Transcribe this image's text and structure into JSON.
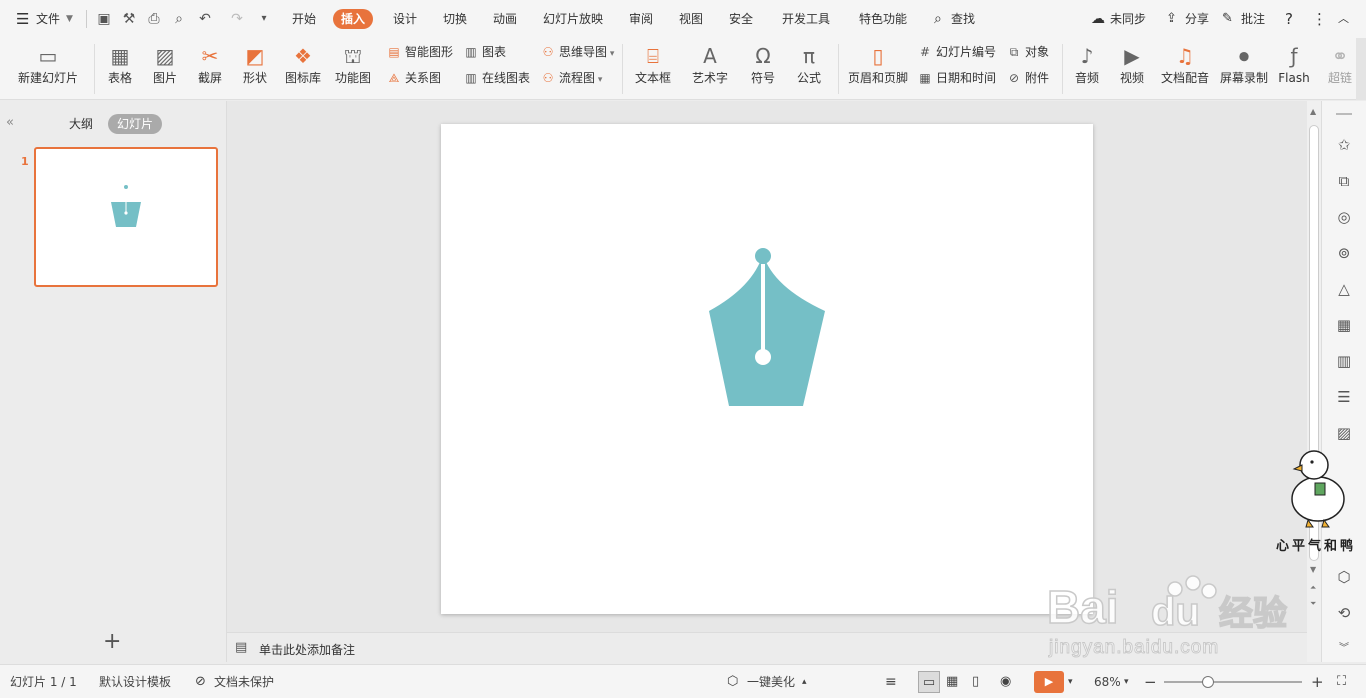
{
  "colors": {
    "accent": "#e8733c",
    "shape": "#75bfc6",
    "slide_bg": "#ffffff"
  },
  "menu": {
    "file_label": "文件",
    "tabs": [
      "开始",
      "插入",
      "设计",
      "切换",
      "动画",
      "幻灯片放映",
      "审阅",
      "视图",
      "安全",
      "开发工具",
      "特色功能"
    ],
    "active_tab": "插入",
    "search_label": "查找",
    "sync_label": "未同步",
    "share_label": "分享",
    "comment_label": "批注"
  },
  "ribbon": {
    "big": [
      {
        "label": "新建幻灯片",
        "icon": "new-slide-icon"
      },
      {
        "label": "表格",
        "icon": "table-icon"
      },
      {
        "label": "图片",
        "icon": "picture-icon"
      },
      {
        "label": "截屏",
        "icon": "screenshot-icon"
      },
      {
        "label": "形状",
        "icon": "shape-icon"
      },
      {
        "label": "图标库",
        "icon": "icon-library-icon"
      },
      {
        "label": "功能图",
        "icon": "function-chart-icon"
      },
      {
        "label": "文本框",
        "icon": "textbox-icon"
      },
      {
        "label": "艺术字",
        "icon": "wordart-icon"
      },
      {
        "label": "符号",
        "icon": "symbol-icon"
      },
      {
        "label": "公式",
        "icon": "formula-icon"
      },
      {
        "label": "页眉和页脚",
        "icon": "header-footer-icon"
      },
      {
        "label": "音频",
        "icon": "audio-icon"
      },
      {
        "label": "视频",
        "icon": "video-icon"
      },
      {
        "label": "文档配音",
        "icon": "dubbing-icon"
      },
      {
        "label": "屏幕录制",
        "icon": "screen-record-icon"
      },
      {
        "label": "Flash",
        "icon": "flash-icon"
      },
      {
        "label": "超链",
        "icon": "hyperlink-icon"
      }
    ],
    "small": {
      "smart_graphic": "智能图形",
      "chart": "图表",
      "relation": "关系图",
      "online_chart": "在线图表",
      "mind_map": "思维导图",
      "flowchart": "流程图",
      "slide_number": "幻灯片编号",
      "object": "对象",
      "date_time": "日期和时间",
      "attachment": "附件"
    }
  },
  "left_panel": {
    "tab_outline": "大纲",
    "tab_slides": "幻灯片",
    "slide_index": "1",
    "add_label": "+"
  },
  "notes_placeholder": "单击此处添加备注",
  "status": {
    "slide_info": "幻灯片 1 / 1",
    "template": "默认设计模板",
    "protect": "文档未保护",
    "beautify": "一键美化",
    "zoom": "68%"
  },
  "watermark": {
    "site": "jingyan.baidu.com",
    "sticker_text": "心平气和鸭"
  }
}
